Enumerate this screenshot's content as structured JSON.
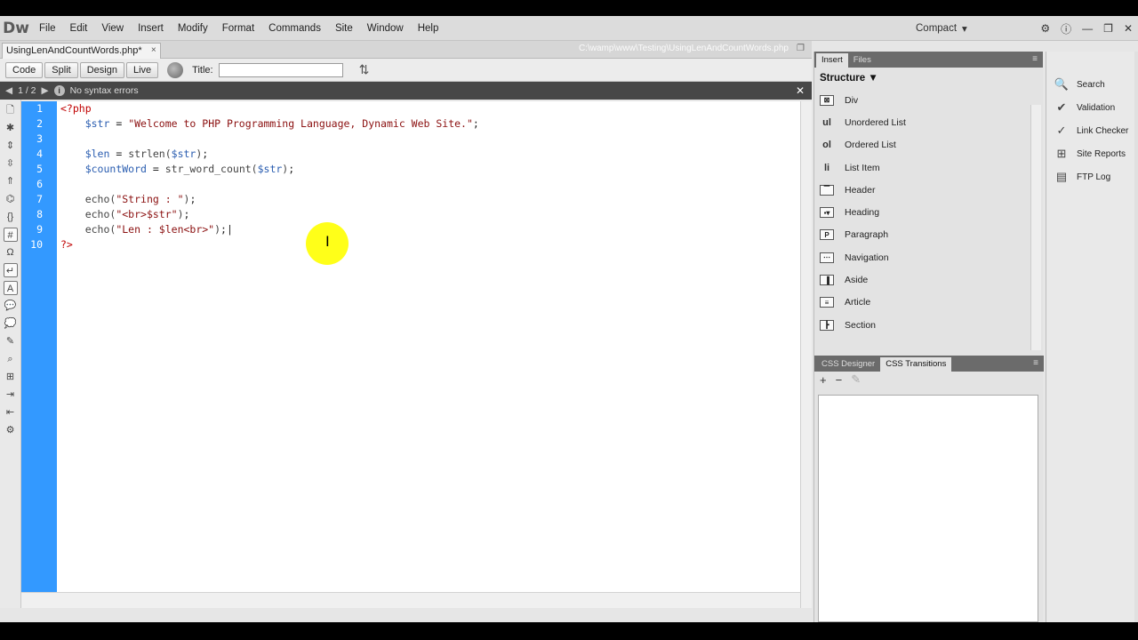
{
  "app": {
    "logo": "Dw",
    "menus": [
      "File",
      "Edit",
      "View",
      "Insert",
      "Modify",
      "Format",
      "Commands",
      "Site",
      "Window",
      "Help"
    ],
    "workspace": "Compact",
    "workspace_arrow": "▾"
  },
  "document": {
    "tab_label": "UsingLenAndCountWords.php*",
    "tab_close": "×",
    "path": "C:\\wamp\\www\\Testing\\UsingLenAndCountWords.php"
  },
  "toolbar": {
    "code": "Code",
    "split": "Split",
    "design": "Design",
    "live": "Live",
    "title_label": "Title:",
    "title_value": ""
  },
  "infobar": {
    "page": "1 / 2",
    "message": "No syntax errors"
  },
  "editor": {
    "line_numbers": [
      "1",
      "2",
      "3",
      "4",
      "5",
      "6",
      "7",
      "8",
      "9",
      "10"
    ]
  },
  "insert_panel": {
    "tabs": [
      "Insert",
      "Files"
    ],
    "category": "Structure",
    "items": [
      {
        "label": "Div",
        "icon": "div-icon"
      },
      {
        "label": "Unordered List",
        "icon": "ul-icon",
        "glyph": "ul"
      },
      {
        "label": "Ordered List",
        "icon": "ol-icon",
        "glyph": "ol"
      },
      {
        "label": "List Item",
        "icon": "li-icon",
        "glyph": "li"
      },
      {
        "label": "Header",
        "icon": "header-icon"
      },
      {
        "label": "Heading",
        "icon": "heading-icon"
      },
      {
        "label": "Paragraph",
        "icon": "paragraph-icon"
      },
      {
        "label": "Navigation",
        "icon": "navigation-icon"
      },
      {
        "label": "Aside",
        "icon": "aside-icon"
      },
      {
        "label": "Article",
        "icon": "article-icon"
      },
      {
        "label": "Section",
        "icon": "section-icon"
      }
    ]
  },
  "css_panel": {
    "tabs": [
      "CSS Designer",
      "CSS Transitions"
    ],
    "add": "+",
    "remove": "−"
  },
  "side_panel": {
    "items": [
      {
        "label": "Search",
        "icon": "search-icon"
      },
      {
        "label": "Validation",
        "icon": "validation-icon"
      },
      {
        "label": "Link Checker",
        "icon": "link-checker-icon"
      },
      {
        "label": "Site Reports",
        "icon": "site-reports-icon"
      },
      {
        "label": "FTP Log",
        "icon": "ftp-log-icon"
      }
    ]
  },
  "colors": {
    "gutter": "#3399ff",
    "highlight": "#ffff00"
  }
}
